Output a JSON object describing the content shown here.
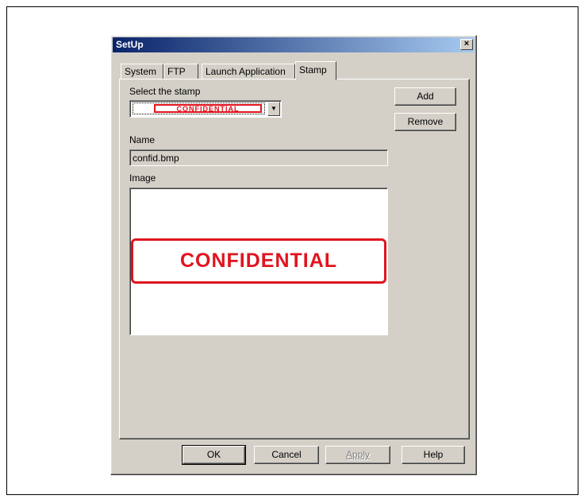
{
  "window": {
    "title": "SetUp",
    "close_glyph": "×"
  },
  "tabs": [
    {
      "label": "System"
    },
    {
      "label": "FTP"
    },
    {
      "label": "Launch Application"
    },
    {
      "label": "Stamp"
    }
  ],
  "active_tab": "Stamp",
  "stamp_panel": {
    "select_label": "Select the stamp",
    "selected_stamp_text": "CONFIDENTIAL",
    "dropdown_glyph": "▼",
    "add_label": "Add",
    "remove_label": "Remove",
    "name_label": "Name",
    "name_value": "confid.bmp",
    "image_label": "Image",
    "image_stamp_text": "CONFIDENTIAL"
  },
  "footer": {
    "ok_label": "OK",
    "cancel_label": "Cancel",
    "apply_label": "Apply",
    "help_label": "Help"
  },
  "colors": {
    "stamp_red": "#e0141e",
    "dialog_face": "#d4d0c8",
    "title_blue": "#0a246a"
  }
}
